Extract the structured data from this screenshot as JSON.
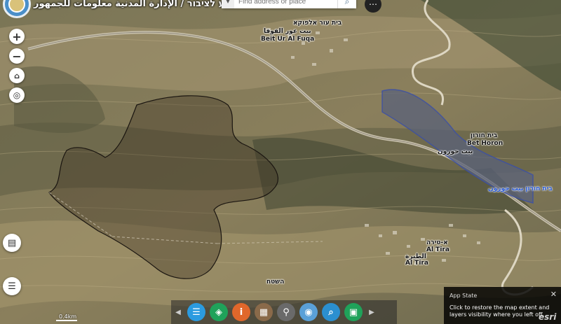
{
  "header": {
    "title": "מנהל אזרחי - מידע לציבור / الإدارة المدنية معلومات للجمهور"
  },
  "search": {
    "placeholder": "Find address or place",
    "chevron_icon": "chevron-down-icon",
    "search_icon": "search-icon"
  },
  "map_labels": [
    {
      "id": "beit-ur-hebrew",
      "text": "בית עור אלפוקא"
    },
    {
      "id": "beit-ur-arabic",
      "text": "بيت عور الفوقا"
    },
    {
      "id": "beit-ur-latin",
      "text": "Beit Ur Al Fuqa"
    },
    {
      "id": "beit-horon-hebrew",
      "text": "בית חורון"
    },
    {
      "id": "beit-horon-latin",
      "text": "Bet Horon"
    },
    {
      "id": "beit-horon-arabic",
      "text": "بيت حورون"
    },
    {
      "id": "beit-horon-blue",
      "text": "בית חורון بيت حورون"
    },
    {
      "id": "al-tira-hebrew",
      "text": "א-טירה"
    },
    {
      "id": "al-tira-latin",
      "text": "Al Tira"
    },
    {
      "id": "al-tira-arabic",
      "text": "الطيرة"
    },
    {
      "id": "al-tira-latin-2",
      "text": "Al Tira"
    },
    {
      "id": "small-label",
      "text": "השטח"
    }
  ],
  "controls": {
    "zoom_in": "+",
    "zoom_out": "−"
  },
  "toolbar": {
    "buttons": [
      {
        "name": "list-icon",
        "color": "#2b9be0"
      },
      {
        "name": "layers-icon",
        "color": "#1fa25a"
      },
      {
        "name": "info-icon",
        "color": "#e0672b"
      },
      {
        "name": "grid-icon",
        "color": "#8a6a4a"
      },
      {
        "name": "pin-icon",
        "color": "#6a6a6a"
      },
      {
        "name": "location-icon",
        "color": "#5aa0d8"
      },
      {
        "name": "search-layer-icon",
        "color": "#2b8fd0"
      },
      {
        "name": "bag-icon",
        "color": "#1fa25a"
      }
    ]
  },
  "app_state": {
    "title": "App State",
    "body": "Click to restore the map extent and layers visibility where you left off."
  },
  "scale": {
    "label": "0.4km"
  },
  "attribution": "esri"
}
